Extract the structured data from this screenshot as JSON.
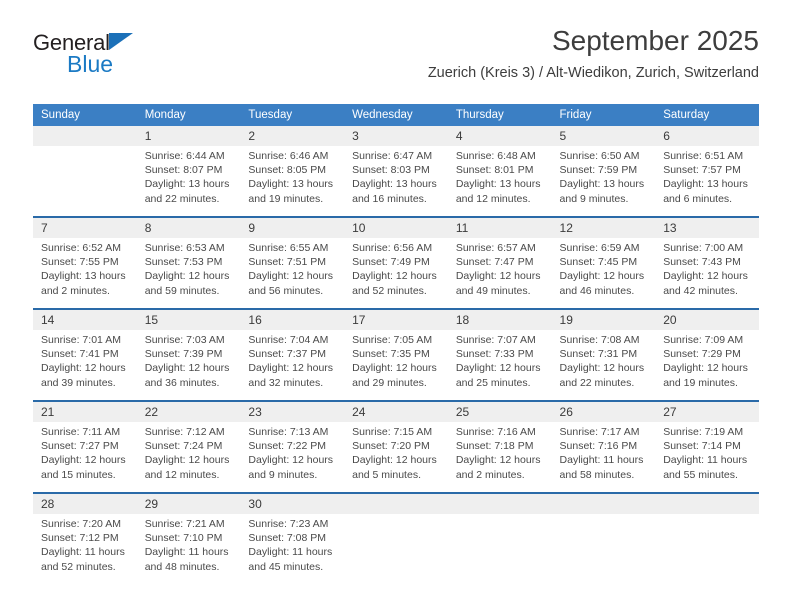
{
  "brand": {
    "name_part1": "General",
    "name_part2": "Blue",
    "triangle_icon": "triangle-icon",
    "colors": {
      "blue": "#1b7ac4",
      "dark": "#231f20"
    }
  },
  "header": {
    "title": "September 2025",
    "subtitle": "Zuerich (Kreis 3) / Alt-Wiedikon, Zurich, Switzerland"
  },
  "theme": {
    "header_bg": "#3b7fc4",
    "separator": "#2a6aa8",
    "daynum_bg": "#efefef",
    "text": "#3b3b3b"
  },
  "columns": [
    "Sunday",
    "Monday",
    "Tuesday",
    "Wednesday",
    "Thursday",
    "Friday",
    "Saturday"
  ],
  "weeks": [
    {
      "days": [
        {
          "num": "",
          "lines": []
        },
        {
          "num": "1",
          "lines": [
            "Sunrise: 6:44 AM",
            "Sunset: 8:07 PM",
            "Daylight: 13 hours",
            "and 22 minutes."
          ]
        },
        {
          "num": "2",
          "lines": [
            "Sunrise: 6:46 AM",
            "Sunset: 8:05 PM",
            "Daylight: 13 hours",
            "and 19 minutes."
          ]
        },
        {
          "num": "3",
          "lines": [
            "Sunrise: 6:47 AM",
            "Sunset: 8:03 PM",
            "Daylight: 13 hours",
            "and 16 minutes."
          ]
        },
        {
          "num": "4",
          "lines": [
            "Sunrise: 6:48 AM",
            "Sunset: 8:01 PM",
            "Daylight: 13 hours",
            "and 12 minutes."
          ]
        },
        {
          "num": "5",
          "lines": [
            "Sunrise: 6:50 AM",
            "Sunset: 7:59 PM",
            "Daylight: 13 hours",
            "and 9 minutes."
          ]
        },
        {
          "num": "6",
          "lines": [
            "Sunrise: 6:51 AM",
            "Sunset: 7:57 PM",
            "Daylight: 13 hours",
            "and 6 minutes."
          ]
        }
      ]
    },
    {
      "days": [
        {
          "num": "7",
          "lines": [
            "Sunrise: 6:52 AM",
            "Sunset: 7:55 PM",
            "Daylight: 13 hours",
            "and 2 minutes."
          ]
        },
        {
          "num": "8",
          "lines": [
            "Sunrise: 6:53 AM",
            "Sunset: 7:53 PM",
            "Daylight: 12 hours",
            "and 59 minutes."
          ]
        },
        {
          "num": "9",
          "lines": [
            "Sunrise: 6:55 AM",
            "Sunset: 7:51 PM",
            "Daylight: 12 hours",
            "and 56 minutes."
          ]
        },
        {
          "num": "10",
          "lines": [
            "Sunrise: 6:56 AM",
            "Sunset: 7:49 PM",
            "Daylight: 12 hours",
            "and 52 minutes."
          ]
        },
        {
          "num": "11",
          "lines": [
            "Sunrise: 6:57 AM",
            "Sunset: 7:47 PM",
            "Daylight: 12 hours",
            "and 49 minutes."
          ]
        },
        {
          "num": "12",
          "lines": [
            "Sunrise: 6:59 AM",
            "Sunset: 7:45 PM",
            "Daylight: 12 hours",
            "and 46 minutes."
          ]
        },
        {
          "num": "13",
          "lines": [
            "Sunrise: 7:00 AM",
            "Sunset: 7:43 PM",
            "Daylight: 12 hours",
            "and 42 minutes."
          ]
        }
      ]
    },
    {
      "days": [
        {
          "num": "14",
          "lines": [
            "Sunrise: 7:01 AM",
            "Sunset: 7:41 PM",
            "Daylight: 12 hours",
            "and 39 minutes."
          ]
        },
        {
          "num": "15",
          "lines": [
            "Sunrise: 7:03 AM",
            "Sunset: 7:39 PM",
            "Daylight: 12 hours",
            "and 36 minutes."
          ]
        },
        {
          "num": "16",
          "lines": [
            "Sunrise: 7:04 AM",
            "Sunset: 7:37 PM",
            "Daylight: 12 hours",
            "and 32 minutes."
          ]
        },
        {
          "num": "17",
          "lines": [
            "Sunrise: 7:05 AM",
            "Sunset: 7:35 PM",
            "Daylight: 12 hours",
            "and 29 minutes."
          ]
        },
        {
          "num": "18",
          "lines": [
            "Sunrise: 7:07 AM",
            "Sunset: 7:33 PM",
            "Daylight: 12 hours",
            "and 25 minutes."
          ]
        },
        {
          "num": "19",
          "lines": [
            "Sunrise: 7:08 AM",
            "Sunset: 7:31 PM",
            "Daylight: 12 hours",
            "and 22 minutes."
          ]
        },
        {
          "num": "20",
          "lines": [
            "Sunrise: 7:09 AM",
            "Sunset: 7:29 PM",
            "Daylight: 12 hours",
            "and 19 minutes."
          ]
        }
      ]
    },
    {
      "days": [
        {
          "num": "21",
          "lines": [
            "Sunrise: 7:11 AM",
            "Sunset: 7:27 PM",
            "Daylight: 12 hours",
            "and 15 minutes."
          ]
        },
        {
          "num": "22",
          "lines": [
            "Sunrise: 7:12 AM",
            "Sunset: 7:24 PM",
            "Daylight: 12 hours",
            "and 12 minutes."
          ]
        },
        {
          "num": "23",
          "lines": [
            "Sunrise: 7:13 AM",
            "Sunset: 7:22 PM",
            "Daylight: 12 hours",
            "and 9 minutes."
          ]
        },
        {
          "num": "24",
          "lines": [
            "Sunrise: 7:15 AM",
            "Sunset: 7:20 PM",
            "Daylight: 12 hours",
            "and 5 minutes."
          ]
        },
        {
          "num": "25",
          "lines": [
            "Sunrise: 7:16 AM",
            "Sunset: 7:18 PM",
            "Daylight: 12 hours",
            "and 2 minutes."
          ]
        },
        {
          "num": "26",
          "lines": [
            "Sunrise: 7:17 AM",
            "Sunset: 7:16 PM",
            "Daylight: 11 hours",
            "and 58 minutes."
          ]
        },
        {
          "num": "27",
          "lines": [
            "Sunrise: 7:19 AM",
            "Sunset: 7:14 PM",
            "Daylight: 11 hours",
            "and 55 minutes."
          ]
        }
      ]
    },
    {
      "days": [
        {
          "num": "28",
          "lines": [
            "Sunrise: 7:20 AM",
            "Sunset: 7:12 PM",
            "Daylight: 11 hours",
            "and 52 minutes."
          ]
        },
        {
          "num": "29",
          "lines": [
            "Sunrise: 7:21 AM",
            "Sunset: 7:10 PM",
            "Daylight: 11 hours",
            "and 48 minutes."
          ]
        },
        {
          "num": "30",
          "lines": [
            "Sunrise: 7:23 AM",
            "Sunset: 7:08 PM",
            "Daylight: 11 hours",
            "and 45 minutes."
          ]
        },
        {
          "num": "",
          "lines": []
        },
        {
          "num": "",
          "lines": []
        },
        {
          "num": "",
          "lines": []
        },
        {
          "num": "",
          "lines": []
        }
      ]
    }
  ]
}
